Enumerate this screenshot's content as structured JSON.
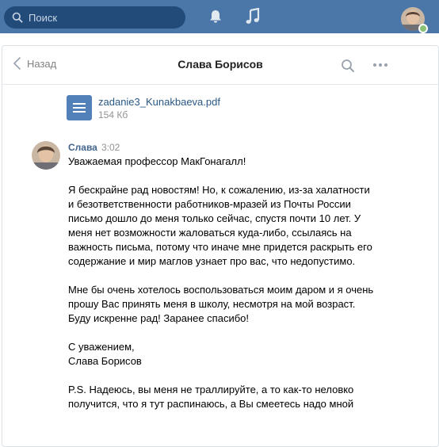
{
  "topbar": {
    "search_placeholder": "Поиск"
  },
  "header": {
    "back_label": "Назад",
    "title": "Слава Борисов"
  },
  "attachment": {
    "name": "zadanie3_Kunakbaeva.pdf",
    "size": "154 Кб"
  },
  "message": {
    "author": "Слава",
    "time": "3:02",
    "paragraphs": [
      "Уважаемая профессор МакГонагалл!",
      "Я бескрайне рад новостям! Но, к сожалению, из-за халатности и безответственности работников-мразей из Почты России письмо дошло до меня только сейчас, спустя почти 10 лет. У меня нет возможности жаловаться куда-либо, ссылаясь на важность письма, потому что иначе мне придется раскрыть его содержание и мир маглов узнает про вас, что недопустимо.",
      "Мне бы очень хотелось воспользоваться моим даром и я очень прошу Вас принять меня в школу, несмотря на мой возраст. Буду искренне рад! Заранее спасибо!",
      "С уважением,\nСлава Борисов",
      "P.S. Надеюсь, вы меня не траллируйте, а то как-то неловко получится, что я тут распинаюсь, а Вы смеетесь надо мной"
    ]
  },
  "colors": {
    "topbar": "#4a76a8",
    "link": "#2a5885",
    "author": "#42648b",
    "online": "#8ac176"
  }
}
